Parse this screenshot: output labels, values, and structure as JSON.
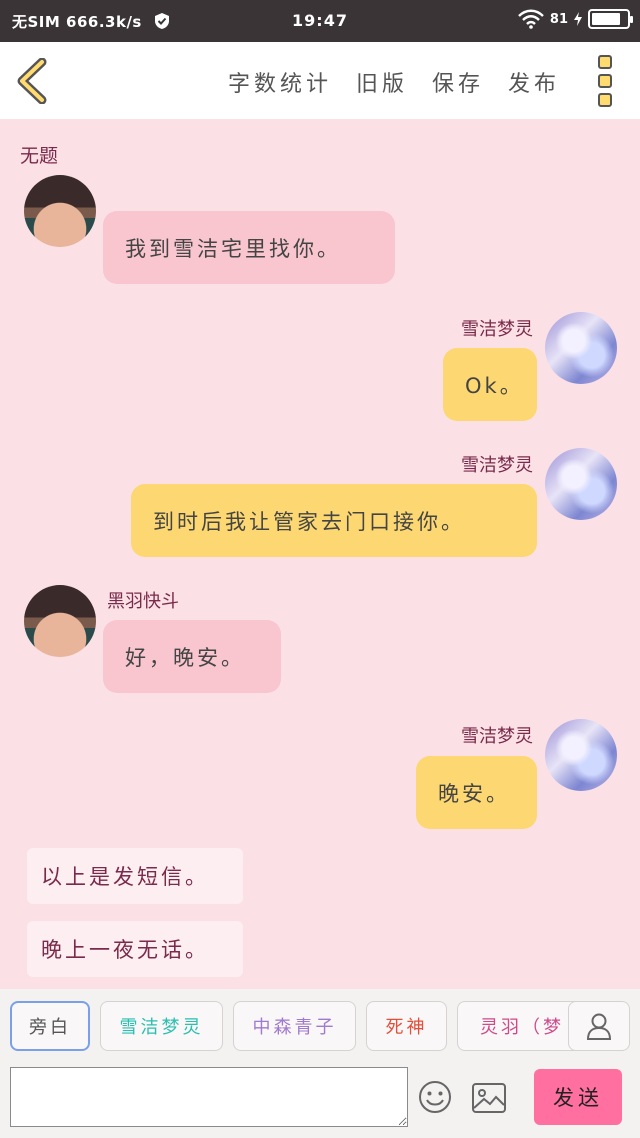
{
  "status_bar": {
    "carrier_speed": "无SIM 666.3k/s",
    "time": "19:47",
    "battery_text": "81",
    "battery_level": 0.81
  },
  "nav": {
    "word_count": "字数统计",
    "old_version": "旧版",
    "save": "保存",
    "publish": "发布"
  },
  "chat": {
    "title": "无题",
    "messages": [
      {
        "sender": "",
        "text": "我到雪洁宅里找你。"
      },
      {
        "sender": "雪洁梦灵",
        "text": "Ok。"
      },
      {
        "sender": "雪洁梦灵",
        "text": "到时后我让管家去门口接你。"
      },
      {
        "sender": "黑羽快斗",
        "text": "好，晚安。"
      },
      {
        "sender": "雪洁梦灵",
        "text": "晚安。"
      }
    ],
    "narrations": [
      "以上是发短信。",
      "晚上一夜无话。"
    ]
  },
  "bottom": {
    "characters": [
      {
        "label": "旁白",
        "color": "#555555"
      },
      {
        "label": "雪洁梦灵",
        "color": "#2bbfb0"
      },
      {
        "label": "中森青子",
        "color": "#a07ad0"
      },
      {
        "label": "死神",
        "color": "#e0503a"
      },
      {
        "label": "灵羽（梦",
        "color": "#d04a8a"
      }
    ],
    "input_placeholder": "",
    "send_label": "发送"
  },
  "colors": {
    "background": "#fbe1e6",
    "bubble_left": "#f9c6d0",
    "bubble_right": "#fdd872",
    "accent": "#ff6f9f"
  }
}
